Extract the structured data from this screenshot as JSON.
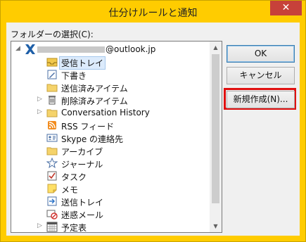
{
  "window": {
    "title": "仕分けルールと通知",
    "close_glyph": "✕"
  },
  "folder_label": {
    "text": "フォルダーの選択(C):"
  },
  "tree": {
    "account": "@outlook.jp",
    "items": [
      {
        "label": "受信トレイ",
        "icon": "inbox-icon",
        "selected": true
      },
      {
        "label": "下書き",
        "icon": "drafts-icon"
      },
      {
        "label": "送信済みアイテム",
        "icon": "folder-icon"
      },
      {
        "label": "削除済みアイテム",
        "icon": "trash-icon",
        "expandable": true
      },
      {
        "label": "Conversation History",
        "icon": "folder-icon",
        "expandable": true
      },
      {
        "label": "RSS フィード",
        "icon": "rss-icon"
      },
      {
        "label": "Skype の連絡先",
        "icon": "contact-card-icon"
      },
      {
        "label": "アーカイブ",
        "icon": "folder-icon"
      },
      {
        "label": "ジャーナル",
        "icon": "journal-icon"
      },
      {
        "label": "タスク",
        "icon": "task-icon"
      },
      {
        "label": "メモ",
        "icon": "notes-icon"
      },
      {
        "label": "送信トレイ",
        "icon": "outbox-icon"
      },
      {
        "label": "迷惑メール",
        "icon": "junk-mail-icon"
      },
      {
        "label": "予定表",
        "icon": "calendar-icon",
        "expandable": true
      }
    ]
  },
  "buttons": {
    "ok": "OK",
    "cancel": "キャンセル",
    "new_folder": "新規作成(N)..."
  },
  "colors": {
    "title_bar": "#ffcc00",
    "highlight": "#e01010",
    "close": "#c7413a"
  }
}
